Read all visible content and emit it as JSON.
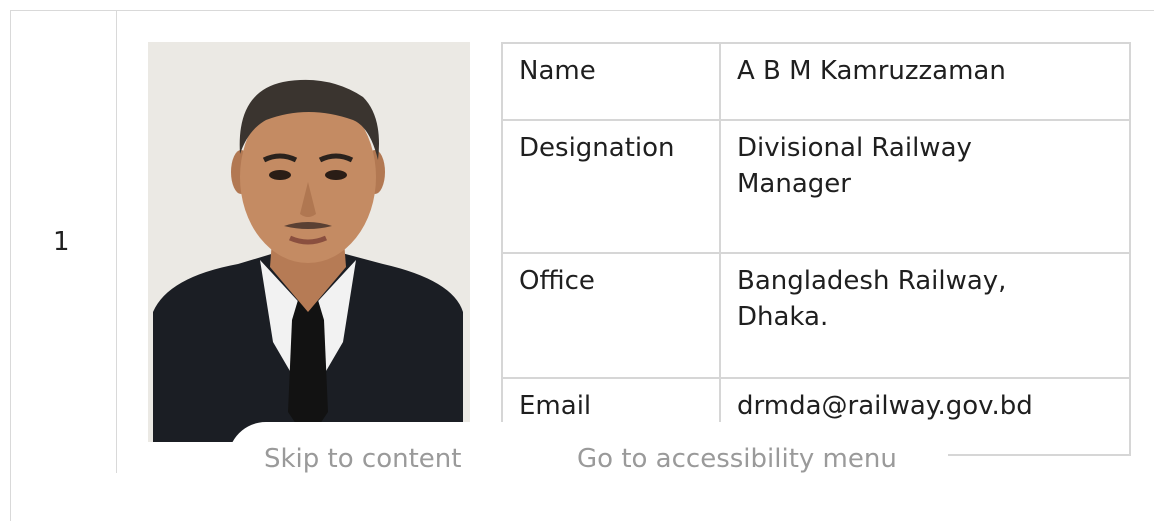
{
  "row": {
    "index": "1",
    "photo_alt": "portrait photo"
  },
  "info": {
    "name_label": "Name",
    "name_value": "A B M Kamruzzaman",
    "designation_label": "Designation",
    "designation_value_line1": "Divisional Railway",
    "designation_value_line2": "Manager",
    "office_label": "Office",
    "office_value_line1": "Bangladesh Railway,",
    "office_value_line2": "Dhaka.",
    "email_label": "Email",
    "email_value": "drmda@railway.gov.bd"
  },
  "skip_links": {
    "skip_to_content": "Skip to content",
    "accessibility_menu": "Go to accessibility menu"
  }
}
